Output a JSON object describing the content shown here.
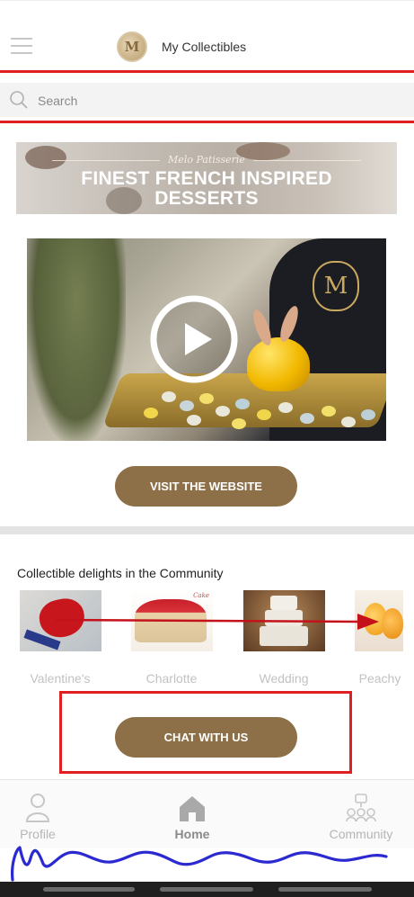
{
  "header": {
    "app_title": "My Collectibles",
    "logo_letter": "M"
  },
  "search": {
    "placeholder": "Search"
  },
  "banner": {
    "brand": "Melo Patisserie",
    "title_line1": "FINEST FRENCH INSPIRED",
    "title_line2": "DESSERTS"
  },
  "video": {
    "badge_letter": "M"
  },
  "buttons": {
    "visit_label": "VISIT THE WEBSITE",
    "chat_label": "CHAT WITH US"
  },
  "community": {
    "heading": "Collectible delights in the Community",
    "items": [
      {
        "label": "Valentine's"
      },
      {
        "label": "Charlotte"
      },
      {
        "label": "Wedding"
      },
      {
        "label": "Peachy"
      }
    ]
  },
  "bottom_nav": {
    "items": [
      {
        "label": "Profile",
        "icon": "person-icon"
      },
      {
        "label": "Home",
        "icon": "home-icon"
      },
      {
        "label": "Community",
        "icon": "community-icon"
      }
    ]
  },
  "colors": {
    "accent": "#8d7048",
    "annotation_red": "#e02020",
    "annotation_blue": "#2a2ad0"
  }
}
